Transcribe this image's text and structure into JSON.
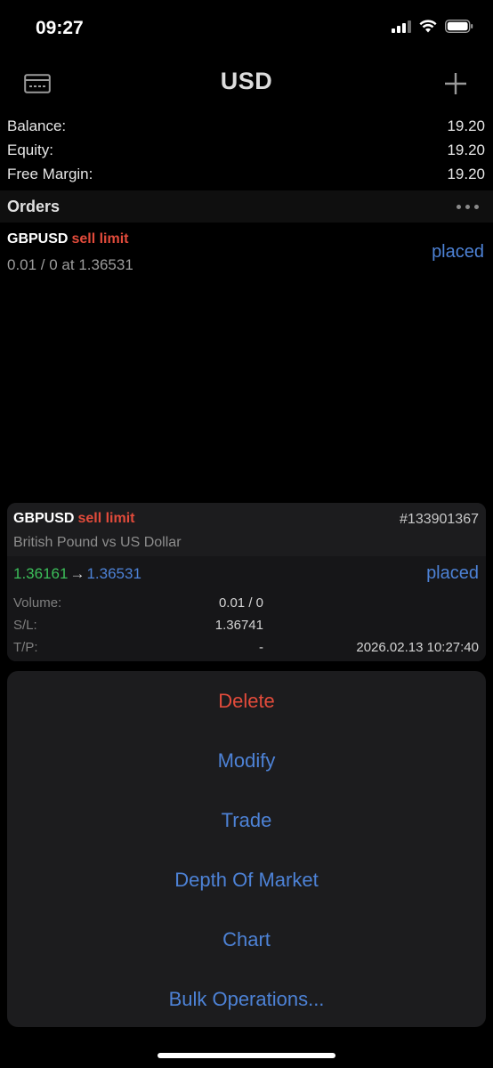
{
  "status_bar": {
    "time": "09:27"
  },
  "nav": {
    "title": "USD",
    "left_icon": "card-icon",
    "right_icon": "plus-icon"
  },
  "account": {
    "balance_label": "Balance:",
    "balance_value": "19.20",
    "equity_label": "Equity:",
    "equity_value": "19.20",
    "free_margin_label": "Free Margin:",
    "free_margin_value": "19.20"
  },
  "orders_section": {
    "title": "Orders"
  },
  "order": {
    "symbol": "GBPUSD",
    "type": "sell limit",
    "details": "0.01 / 0 at 1.36531",
    "status": "placed"
  },
  "detail_card": {
    "symbol": "GBPUSD",
    "type": "sell limit",
    "ticket": "#133901367",
    "description": "British Pound vs US Dollar",
    "price_from": "1.36161",
    "arrow": "→",
    "price_to": "1.36531",
    "status": "placed",
    "volume_label": "Volume:",
    "volume_value": "0.01 / 0",
    "sl_label": "S/L:",
    "sl_value": "1.36741",
    "tp_label": "T/P:",
    "tp_value": "-",
    "time": "2026.02.13 10:27:40"
  },
  "actions": {
    "delete": "Delete",
    "modify": "Modify",
    "trade": "Trade",
    "depth": "Depth Of Market",
    "chart": "Chart",
    "bulk": "Bulk Operations..."
  },
  "colors": {
    "accent_blue": "#4d82d6",
    "sell_red": "#e24b3b",
    "price_green": "#3cbf5a"
  }
}
